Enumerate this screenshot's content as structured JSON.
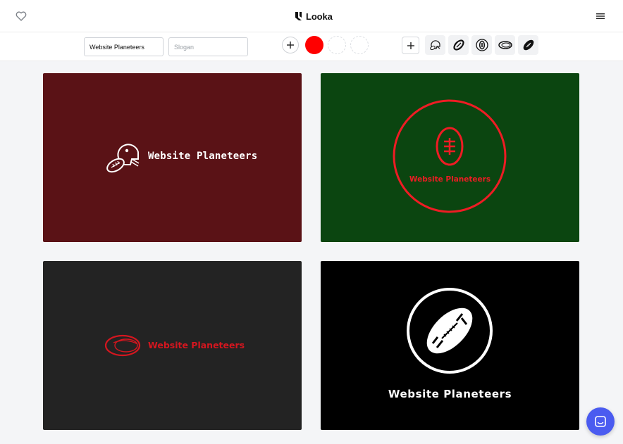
{
  "header": {
    "brand_name": "Looka",
    "favorites_icon": "heart-icon",
    "menu_icon": "hamburger-menu-icon"
  },
  "toolbar": {
    "company_name_value": "Website Planeteers",
    "slogan_placeholder": "Slogan",
    "add_color_icon": "plus-icon",
    "colors": [
      "#ff0000",
      "",
      ""
    ],
    "add_symbol_icon": "plus-icon",
    "symbol_icons": [
      "football-helmet-icon",
      "football-tilted-icon",
      "football-upright-icon",
      "football-oval-icon",
      "football-black-icon"
    ]
  },
  "logos": [
    {
      "name": "Website Planeteers",
      "background": "#5a1216",
      "color": "#ffffff",
      "symbol": "football-helmet-icon"
    },
    {
      "name": "Website Planeteers",
      "background": "#0b4510",
      "color": "#ee1c24",
      "symbol": "football-upright-icon"
    },
    {
      "name": "Website Planeteers",
      "background": "#232323",
      "color": "#d4161f",
      "symbol": "football-oval-icon"
    },
    {
      "name": "Website Planeteers",
      "background": "#000000",
      "color": "#ffffff",
      "symbol": "football-black-icon"
    }
  ],
  "support": {
    "icon": "chat-bubble-icon",
    "accent": "#4a5bf0"
  }
}
